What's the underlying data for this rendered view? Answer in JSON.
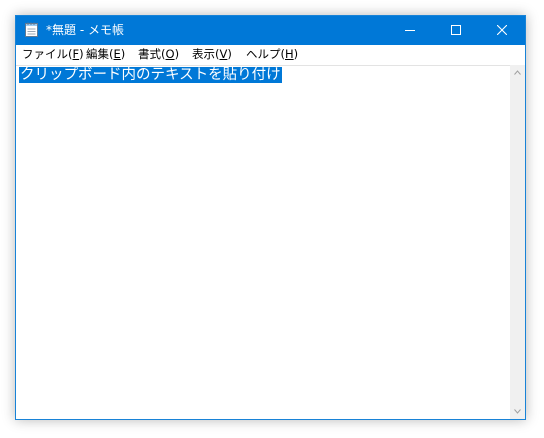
{
  "window": {
    "title": "*無題 - メモ帳",
    "accent_color": "#0078d7",
    "caption_buttons": [
      "minimize-icon",
      "maximize-icon",
      "close-icon"
    ]
  },
  "menu": {
    "file": {
      "label": "ファイル(",
      "key": "F",
      "suffix": ")"
    },
    "edit": {
      "label": "編集(",
      "key": "E",
      "suffix": ")"
    },
    "format": {
      "label": "書式(",
      "key": "O",
      "suffix": ")"
    },
    "view": {
      "label": "表示(",
      "key": "V",
      "suffix": ")"
    },
    "help": {
      "label": "ヘルプ(",
      "key": "H",
      "suffix": ")"
    }
  },
  "editor": {
    "text": "クリップボード内のテキストを貼り付け"
  },
  "scrollbar": {
    "up_icon": "chevron-up-icon",
    "down_icon": "chevron-down-icon"
  }
}
